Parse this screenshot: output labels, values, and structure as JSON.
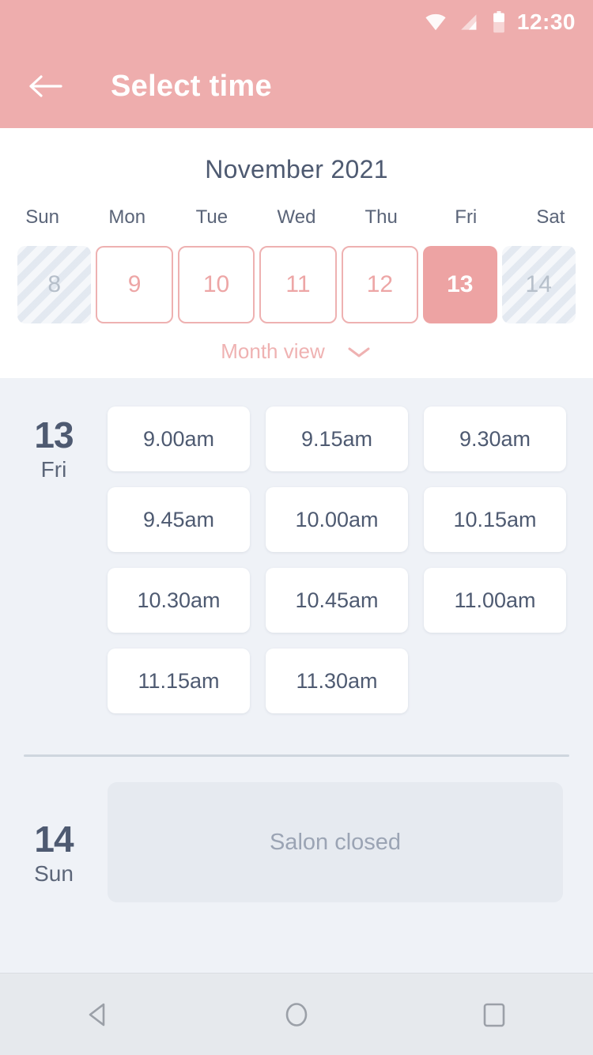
{
  "statusbar": {
    "time": "12:30",
    "icons": [
      "wifi-icon",
      "signal-icon",
      "battery-icon"
    ]
  },
  "appbar": {
    "back_icon": "back-arrow-icon",
    "title": "Select time"
  },
  "calendar": {
    "month_title": "November 2021",
    "weekdays": [
      "Sun",
      "Mon",
      "Tue",
      "Wed",
      "Thu",
      "Fri",
      "Sat"
    ],
    "days": [
      {
        "label": "8",
        "state": "disabled"
      },
      {
        "label": "9",
        "state": "available"
      },
      {
        "label": "10",
        "state": "available"
      },
      {
        "label": "11",
        "state": "available"
      },
      {
        "label": "12",
        "state": "available"
      },
      {
        "label": "13",
        "state": "selected"
      },
      {
        "label": "14",
        "state": "disabled"
      }
    ],
    "month_view_label": "Month view",
    "month_view_icon": "chevron-down-icon"
  },
  "schedule": [
    {
      "day_number": "13",
      "day_name": "Fri",
      "slots": [
        "9.00am",
        "9.15am",
        "9.30am",
        "9.45am",
        "10.00am",
        "10.15am",
        "10.30am",
        "10.45am",
        "11.00am",
        "11.15am",
        "11.30am"
      ],
      "closed_message": null
    },
    {
      "day_number": "14",
      "day_name": "Sun",
      "slots": [],
      "closed_message": "Salon closed"
    }
  ],
  "navbar": {
    "back": "nav-back-icon",
    "home": "nav-home-icon",
    "recents": "nav-recents-icon"
  },
  "colors": {
    "accent": "#eeadad",
    "accent_selected": "#eda3a3",
    "accent_border": "#eeb1b1",
    "text_dark": "#4e5a71",
    "background": "#eff2f7",
    "card": "#ffffff",
    "closed_card": "#e6eaf0",
    "closed_text": "#9ba4b4"
  }
}
